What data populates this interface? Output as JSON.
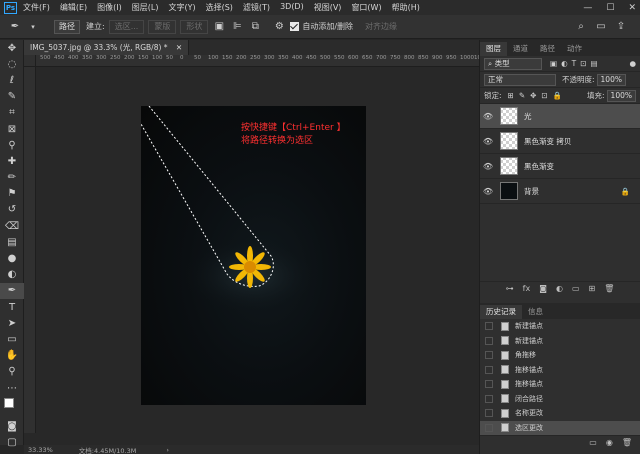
{
  "menubar": {
    "logo": "Ps",
    "items": [
      "文件(F)",
      "编辑(E)",
      "图像(I)",
      "图层(L)",
      "文字(Y)",
      "选择(S)",
      "滤镜(T)",
      "3D(D)",
      "视图(V)",
      "窗口(W)",
      "帮助(H)"
    ],
    "window_buttons": [
      "—",
      "☐",
      "✕"
    ]
  },
  "options": {
    "mode": "路径",
    "make_label": "建立:",
    "btn_selection": "选区...",
    "btn_mask": "蒙版",
    "btn_shape": "形状",
    "auto_add": "自动添加/删除",
    "align_edges": "对齐边缘"
  },
  "document": {
    "tab_title": "IMG_5037.jpg @ 33.3% (光, RGB/8) *",
    "ruler_ticks": [
      "500",
      "450",
      "400",
      "350",
      "300",
      "250",
      "200",
      "150",
      "100",
      "50",
      "0",
      "50",
      "100",
      "150",
      "200",
      "250",
      "300",
      "350",
      "400",
      "450",
      "500",
      "550",
      "600",
      "650",
      "700",
      "750",
      "800",
      "850",
      "900",
      "950",
      "1000",
      "1050"
    ],
    "annotation_line1": "按快捷键【Ctrl+Enter 】",
    "annotation_line2": "将路径转换为选区",
    "zoom": "33.33%",
    "doc_info": "文档:4.45M/10.3M"
  },
  "layers_panel": {
    "tabs": [
      "图层",
      "通道",
      "路径",
      "动作"
    ],
    "filter_kind": "类型",
    "blend_mode": "正常",
    "opacity_label": "不透明度:",
    "opacity_value": "100%",
    "lock_label": "锁定:",
    "fill_label": "填充:",
    "fill_value": "100%",
    "layers": [
      {
        "name": "光",
        "selected": true,
        "thumb": "transparent"
      },
      {
        "name": "黑色渐变 拷贝",
        "selected": false,
        "thumb": "transparent"
      },
      {
        "name": "黑色渐变",
        "selected": false,
        "thumb": "transparent"
      },
      {
        "name": "背景",
        "selected": false,
        "thumb": "photo",
        "locked": true
      }
    ]
  },
  "history_panel": {
    "tabs": [
      "历史记录",
      "信息"
    ],
    "items": [
      "新建锚点",
      "新建锚点",
      "角拖移",
      "拖移锚点",
      "拖移锚点",
      "闭合路径",
      "名称更改",
      "选区更改"
    ],
    "selected_index": 7
  }
}
